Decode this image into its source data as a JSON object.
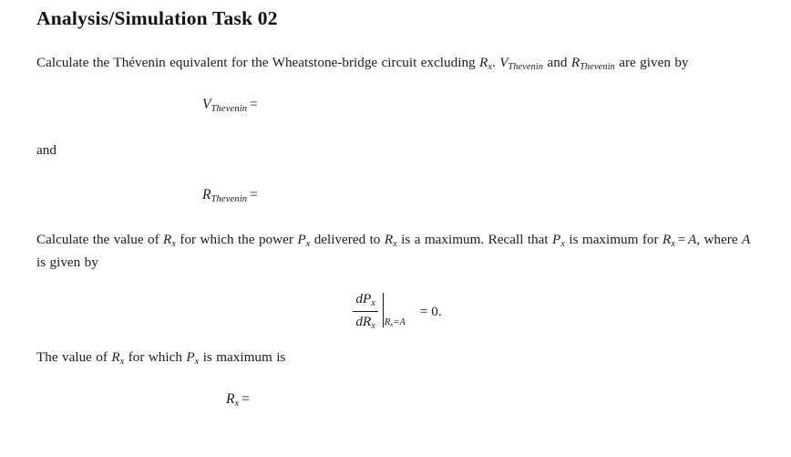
{
  "document": {
    "title": "Analysis/Simulation Task 02",
    "background_color": "#ffffff",
    "text_color": "#1b1b1b"
  },
  "paragraph_1": {
    "seg_1": "Calculate the Thévenin equivalent for the Wheatstone-bridge circuit excluding ",
    "math_rx": "R",
    "math_rx_sub": "x",
    "seg_2": ". ",
    "math_vth": "V",
    "math_vth_sub": "Thevenin",
    "seg_3": " and ",
    "math_rth": "R",
    "math_rth_sub": "Thevenin",
    "seg_4": " are given by"
  },
  "equation_1": {
    "symbol": "V",
    "subscript": "Thevenin",
    "operator": "=",
    "answer": ""
  },
  "connector": {
    "text": "and"
  },
  "equation_2": {
    "symbol": "R",
    "subscript": "Thevenin",
    "operator": "=",
    "answer": ""
  },
  "paragraph_2": {
    "seg_1": "Calculate the value of ",
    "math_rx": "R",
    "math_rx_sub": "x",
    "seg_2": " for which the power ",
    "math_px": "P",
    "math_px_sub": "x",
    "seg_3": " delivered to ",
    "math_rx2": "R",
    "math_rx2_sub": "x",
    "seg_4": " is a maximum. Recall that ",
    "math_px2": "P",
    "math_px2_sub": "x",
    "seg_5": " is maximum for ",
    "math_rx3": "R",
    "math_rx3_sub": "x",
    "seg_6_eq": "=",
    "math_a": "A",
    "seg_7": ", where ",
    "math_a2": "A",
    "seg_8": " is given by"
  },
  "equation_3": {
    "numerator_symbol": "d",
    "numerator_var": "P",
    "numerator_sub": "x",
    "denominator_symbol": "d",
    "denominator_var": "R",
    "denominator_sub": "x",
    "eval_var": "R",
    "eval_var_sub": "x",
    "eval_eq": "=",
    "eval_value": "A",
    "result": "= 0."
  },
  "paragraph_3": {
    "seg_1": "The value of ",
    "math_rx": "R",
    "math_rx_sub": "x",
    "seg_2": " for which ",
    "math_px": "P",
    "math_px_sub": "x",
    "seg_3": " is maximum is"
  },
  "equation_4": {
    "symbol": "R",
    "subscript": "x",
    "operator": "=",
    "answer": ""
  }
}
